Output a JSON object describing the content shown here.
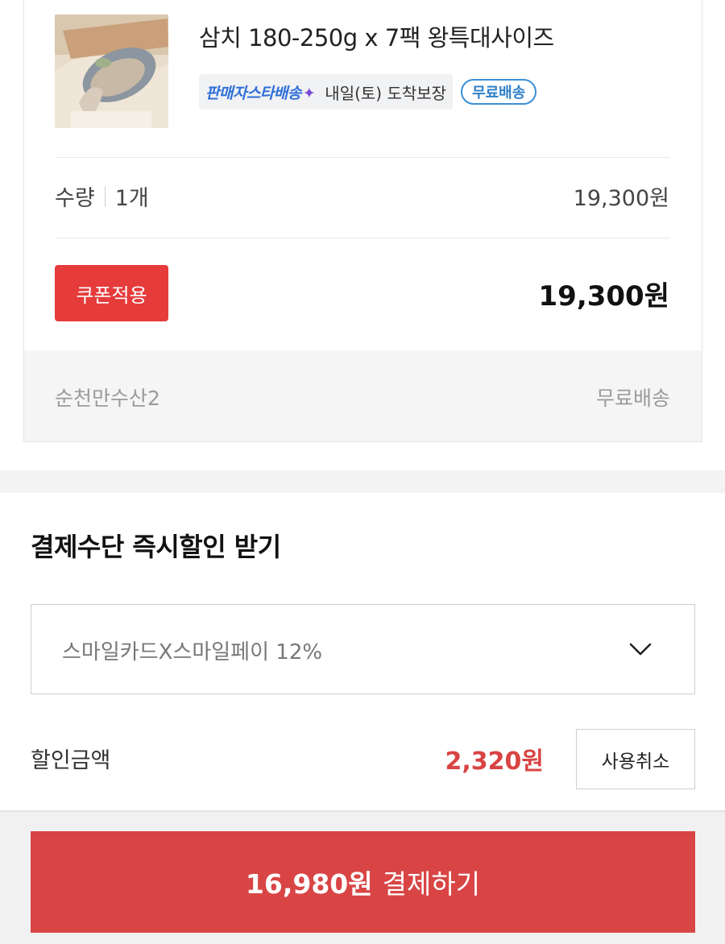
{
  "product": {
    "name": "삼치 180-250g x 7팩 왕특대사이즈",
    "image_alt": "삼치 상품 이미지",
    "seller_delivery_badge": "판매자스타배송",
    "arrival_text": "내일(토) 도착보장",
    "free_shipping_badge": "무료배송",
    "quantity_label": "수량",
    "quantity_value": "1개",
    "unit_price": "19,300원",
    "coupon_button": "쿠폰적용",
    "total_price": "19,300원"
  },
  "seller": {
    "name": "순천만수산2",
    "shipping": "무료배송"
  },
  "payment_discount": {
    "title": "결제수단 즉시할인 받기",
    "selected_method": "스마일카드X스마일페이 12%",
    "discount_label": "할인금액",
    "discount_amount": "2,320원",
    "cancel_button": "사용취소"
  },
  "checkout": {
    "amount": "16,980원",
    "label": "결제하기"
  },
  "colors": {
    "accent_red": "#e53b3b",
    "pay_red": "#d94545",
    "discount_red": "#d94343",
    "free_shipping_blue": "#2f7fc8"
  }
}
